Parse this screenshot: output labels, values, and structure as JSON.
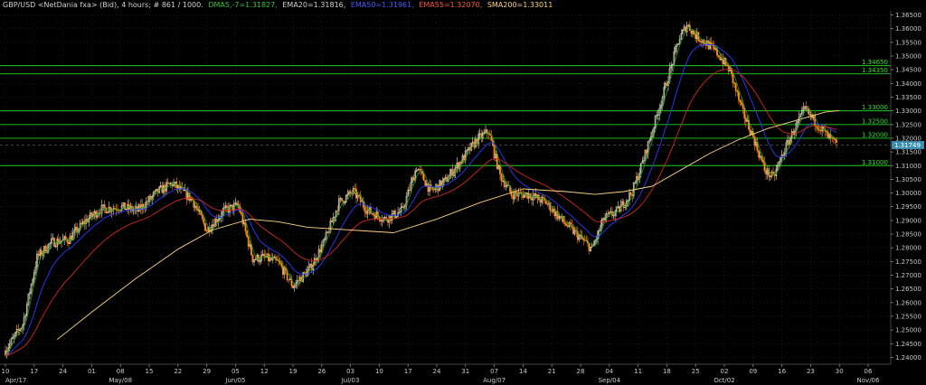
{
  "header": {
    "symbol": "GBP/USD <NetDania fxa> (Bid), 4 hours; # 861 / 1000.",
    "dma": "DMA5,-7=1.31827,",
    "ema20": "EMA20=1.31816,",
    "ema50": "EMA50=1.31961,",
    "ema55": "EMA55=1.32070,",
    "sma200": "SMA200=1.33011"
  },
  "colors": {
    "background": "#000000",
    "grid": "#2a2a2a",
    "candle_up": "#e0e0c0",
    "candle_down": "#ff8c1a",
    "dma": "#1e9b1e",
    "ema20": "#2a3cff",
    "ema50": "#2a3cff",
    "ema55": "#d22a1e",
    "sma200": "#ffd27a",
    "level": "#1ed01e",
    "current_price_box": "#3a8fb0"
  },
  "chart_data": {
    "type": "candlestick",
    "title": "GBP/USD <NetDania fxa> (Bid), 4 hours",
    "x_tick_labels": [
      "10",
      "17",
      "24",
      "01",
      "08",
      "15",
      "22",
      "29",
      "05",
      "12",
      "19",
      "26",
      "03",
      "10",
      "17",
      "24",
      "31",
      "07",
      "14",
      "21",
      "28",
      "04",
      "11",
      "18",
      "25",
      "02",
      "09",
      "16",
      "23",
      "30",
      "06"
    ],
    "x_month_labels": [
      {
        "text": "Apr/17",
        "at_tick": 0
      },
      {
        "text": "May/08",
        "at_tick": 4
      },
      {
        "text": "Jun/05",
        "at_tick": 8
      },
      {
        "text": "Jul/03",
        "at_tick": 12
      },
      {
        "text": "Aug/07",
        "at_tick": 17
      },
      {
        "text": "Sep/04",
        "at_tick": 21
      },
      {
        "text": "Oct/02",
        "at_tick": 25
      },
      {
        "text": "Nov/06",
        "at_tick": 30
      }
    ],
    "y_tick_labels": [
      "1.36500",
      "1.36000",
      "1.35500",
      "1.35000",
      "1.34500",
      "1.34000",
      "1.33500",
      "1.33000",
      "1.32500",
      "1.32000",
      "1.31500",
      "1.31000",
      "1.30500",
      "1.30000",
      "1.29500",
      "1.29000",
      "1.28500",
      "1.28000",
      "1.27500",
      "1.27000",
      "1.26500",
      "1.26000",
      "1.25500",
      "1.25000",
      "1.24500",
      "1.24000"
    ],
    "ylim": [
      1.2375,
      1.3665
    ],
    "horizontal_levels": [
      {
        "label": "1.34650",
        "value": 1.3465
      },
      {
        "label": "1.34350",
        "value": 1.3435
      },
      {
        "label": "1.33000",
        "value": 1.33
      },
      {
        "label": "1.32500",
        "value": 1.325
      },
      {
        "label": "1.32000",
        "value": 1.32
      },
      {
        "label": "1.31000",
        "value": 1.31
      }
    ],
    "current_price": {
      "label": "1.31749",
      "value": 1.31749
    },
    "price_path": [
      {
        "t": 0,
        "v": 1.2425
      },
      {
        "t": 0.6,
        "v": 1.252
      },
      {
        "t": 1.1,
        "v": 1.2765
      },
      {
        "t": 1.6,
        "v": 1.282
      },
      {
        "t": 2.2,
        "v": 1.283
      },
      {
        "t": 2.8,
        "v": 1.29
      },
      {
        "t": 3.3,
        "v": 1.294
      },
      {
        "t": 4.0,
        "v": 1.295
      },
      {
        "t": 4.6,
        "v": 1.2935
      },
      {
        "t": 5.3,
        "v": 1.3005
      },
      {
        "t": 5.8,
        "v": 1.3035
      },
      {
        "t": 6.5,
        "v": 1.2975
      },
      {
        "t": 7.0,
        "v": 1.2865
      },
      {
        "t": 7.6,
        "v": 1.2935
      },
      {
        "t": 8.1,
        "v": 1.2955
      },
      {
        "t": 8.6,
        "v": 1.276
      },
      {
        "t": 9.0,
        "v": 1.2765
      },
      {
        "t": 9.5,
        "v": 1.2745
      },
      {
        "t": 10.0,
        "v": 1.266
      },
      {
        "t": 10.6,
        "v": 1.2725
      },
      {
        "t": 11.1,
        "v": 1.2825
      },
      {
        "t": 11.6,
        "v": 1.2965
      },
      {
        "t": 12.1,
        "v": 1.3005
      },
      {
        "t": 12.6,
        "v": 1.2935
      },
      {
        "t": 13.2,
        "v": 1.2905
      },
      {
        "t": 13.8,
        "v": 1.2935
      },
      {
        "t": 14.3,
        "v": 1.3095
      },
      {
        "t": 14.8,
        "v": 1.3005
      },
      {
        "t": 15.3,
        "v": 1.3045
      },
      {
        "t": 15.9,
        "v": 1.3125
      },
      {
        "t": 16.4,
        "v": 1.3195
      },
      {
        "t": 16.8,
        "v": 1.3225
      },
      {
        "t": 17.2,
        "v": 1.3065
      },
      {
        "t": 17.6,
        "v": 1.2995
      },
      {
        "t": 18.2,
        "v": 1.2995
      },
      {
        "t": 18.8,
        "v": 1.2965
      },
      {
        "t": 19.4,
        "v": 1.2895
      },
      {
        "t": 20.0,
        "v": 1.2835
      },
      {
        "t": 20.4,
        "v": 1.2795
      },
      {
        "t": 20.8,
        "v": 1.2905
      },
      {
        "t": 21.3,
        "v": 1.2935
      },
      {
        "t": 21.8,
        "v": 1.3005
      },
      {
        "t": 22.2,
        "v": 1.3125
      },
      {
        "t": 22.6,
        "v": 1.3265
      },
      {
        "t": 23.0,
        "v": 1.3405
      },
      {
        "t": 23.4,
        "v": 1.3555
      },
      {
        "t": 23.7,
        "v": 1.3615
      },
      {
        "t": 24.0,
        "v": 1.3575
      },
      {
        "t": 24.4,
        "v": 1.3545
      },
      {
        "t": 24.8,
        "v": 1.3505
      },
      {
        "t": 25.2,
        "v": 1.3445
      },
      {
        "t": 25.6,
        "v": 1.3305
      },
      {
        "t": 26.0,
        "v": 1.3205
      },
      {
        "t": 26.4,
        "v": 1.3085
      },
      {
        "t": 26.7,
        "v": 1.3055
      },
      {
        "t": 27.0,
        "v": 1.3135
      },
      {
        "t": 27.4,
        "v": 1.3225
      },
      {
        "t": 27.8,
        "v": 1.3305
      },
      {
        "t": 28.2,
        "v": 1.3255
      },
      {
        "t": 28.6,
        "v": 1.3205
      },
      {
        "t": 28.9,
        "v": 1.3175
      }
    ],
    "sma200_path": [
      {
        "t": 1.8,
        "v": 1.2465
      },
      {
        "t": 3.0,
        "v": 1.2565
      },
      {
        "t": 4.5,
        "v": 1.2685
      },
      {
        "t": 6.0,
        "v": 1.2795
      },
      {
        "t": 7.2,
        "v": 1.2865
      },
      {
        "t": 8.5,
        "v": 1.2905
      },
      {
        "t": 9.5,
        "v": 1.2895
      },
      {
        "t": 10.5,
        "v": 1.2875
      },
      {
        "t": 12.0,
        "v": 1.2865
      },
      {
        "t": 13.5,
        "v": 1.2855
      },
      {
        "t": 15.0,
        "v": 1.2905
      },
      {
        "t": 16.5,
        "v": 1.2965
      },
      {
        "t": 18.0,
        "v": 1.3015
      },
      {
        "t": 19.5,
        "v": 1.3005
      },
      {
        "t": 20.5,
        "v": 1.2995
      },
      {
        "t": 21.5,
        "v": 1.3005
      },
      {
        "t": 22.5,
        "v": 1.3025
      },
      {
        "t": 23.5,
        "v": 1.3085
      },
      {
        "t": 24.5,
        "v": 1.3145
      },
      {
        "t": 25.5,
        "v": 1.3195
      },
      {
        "t": 26.5,
        "v": 1.3235
      },
      {
        "t": 27.5,
        "v": 1.3265
      },
      {
        "t": 28.5,
        "v": 1.3295
      },
      {
        "t": 29.0,
        "v": 1.3301
      }
    ],
    "grid": true
  }
}
